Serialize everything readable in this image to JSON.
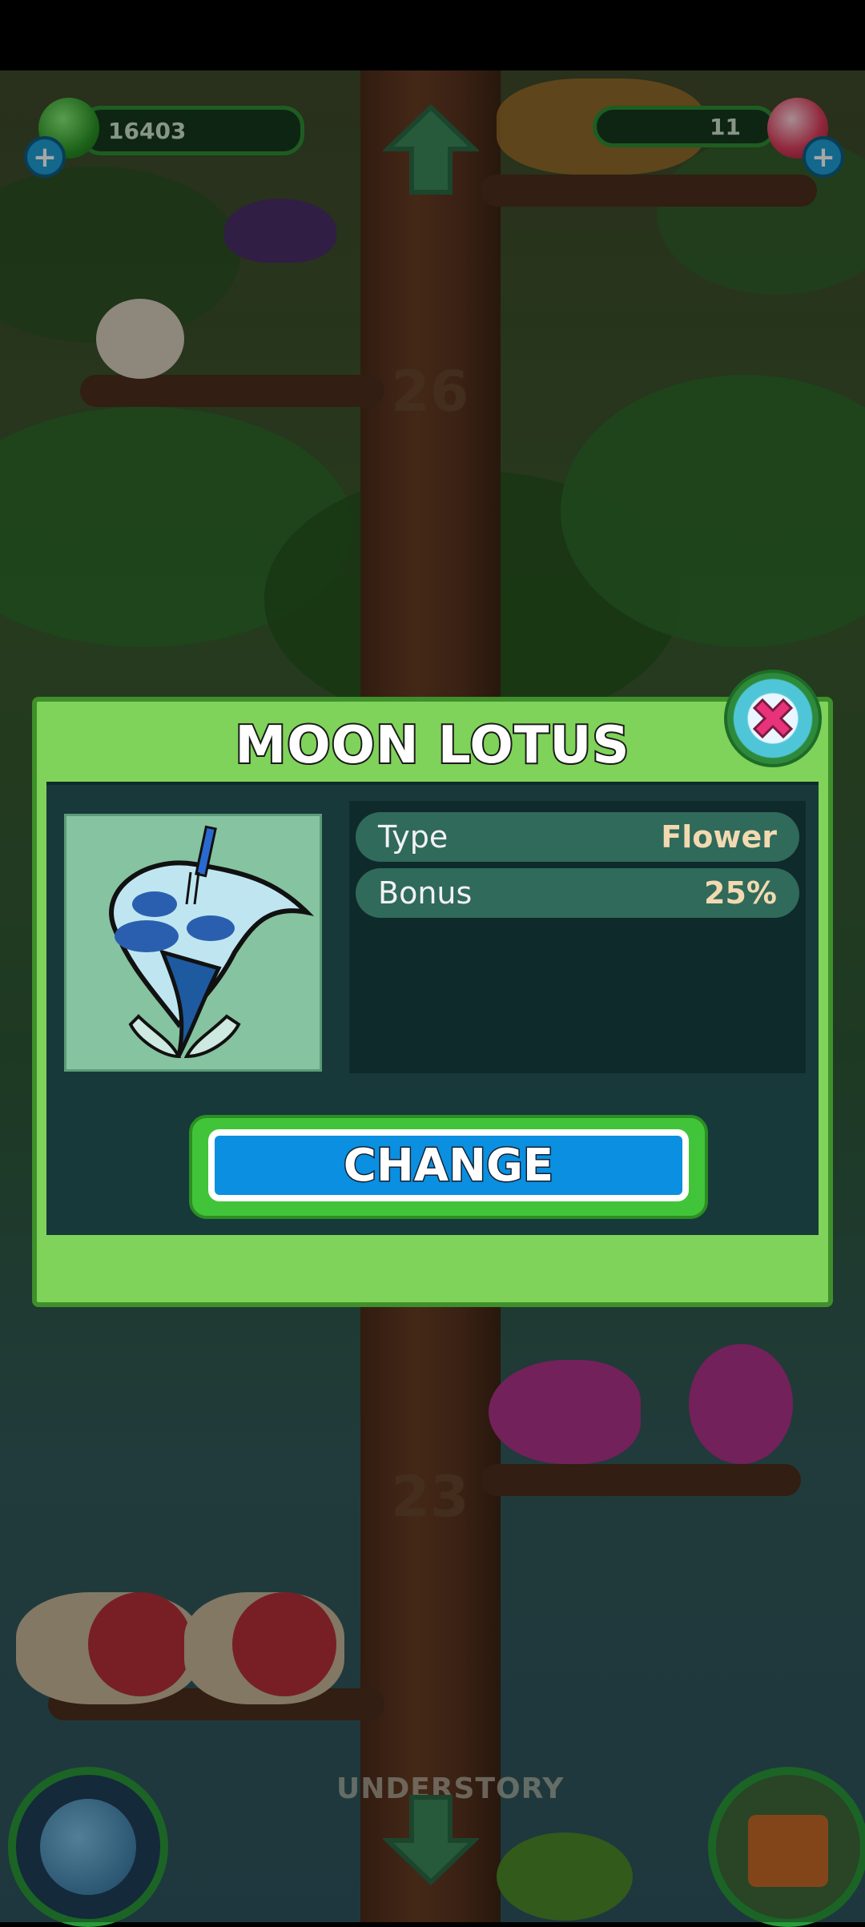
{
  "hud": {
    "coins": "16403",
    "gems": "11",
    "add_coins_icon": "plus-icon",
    "add_gems_icon": "plus-icon"
  },
  "world": {
    "floor_upper": "26",
    "floor_lower": "23",
    "zone": "UNDERSTORY"
  },
  "dialog": {
    "title": "MOON LOTUS",
    "stats": [
      {
        "label": "Type",
        "value": "Flower"
      },
      {
        "label": "Bonus",
        "value": "25%"
      }
    ],
    "button": "CHANGE",
    "close_icon": "close-icon"
  },
  "colors": {
    "dialog_bg": "#7fd25a",
    "panel_bg": "#17393a",
    "button_blue": "#0b8fe0",
    "close_pink": "#e8327a"
  }
}
